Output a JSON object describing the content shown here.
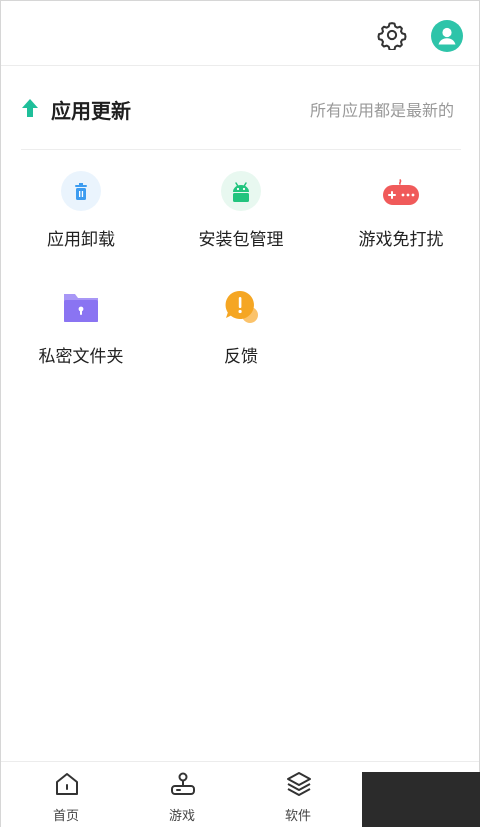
{
  "colors": {
    "accent": "#2ec4a9",
    "update_arrow": "#1fbf9a",
    "uninstall_icon": "#3d9cf0",
    "package_icon": "#22c47e",
    "game_icon": "#f05a5a",
    "folder_icon": "#8a74f2",
    "feedback_icon": "#f5a623"
  },
  "topbar": {
    "settings_icon": "gear-icon",
    "avatar_icon": "user-avatar-icon"
  },
  "update": {
    "title": "应用更新",
    "status": "所有应用都是最新的"
  },
  "tools": [
    {
      "label": "应用卸载",
      "icon": "trash-icon"
    },
    {
      "label": "安装包管理",
      "icon": "android-icon"
    },
    {
      "label": "游戏免打扰",
      "icon": "gamepad-icon"
    },
    {
      "label": "私密文件夹",
      "icon": "locked-folder-icon"
    },
    {
      "label": "反馈",
      "icon": "feedback-bubble-icon"
    }
  ],
  "bottom_nav": [
    {
      "label": "首页",
      "icon": "home-icon"
    },
    {
      "label": "游戏",
      "icon": "joystick-icon"
    },
    {
      "label": "软件",
      "icon": "layers-icon"
    }
  ]
}
